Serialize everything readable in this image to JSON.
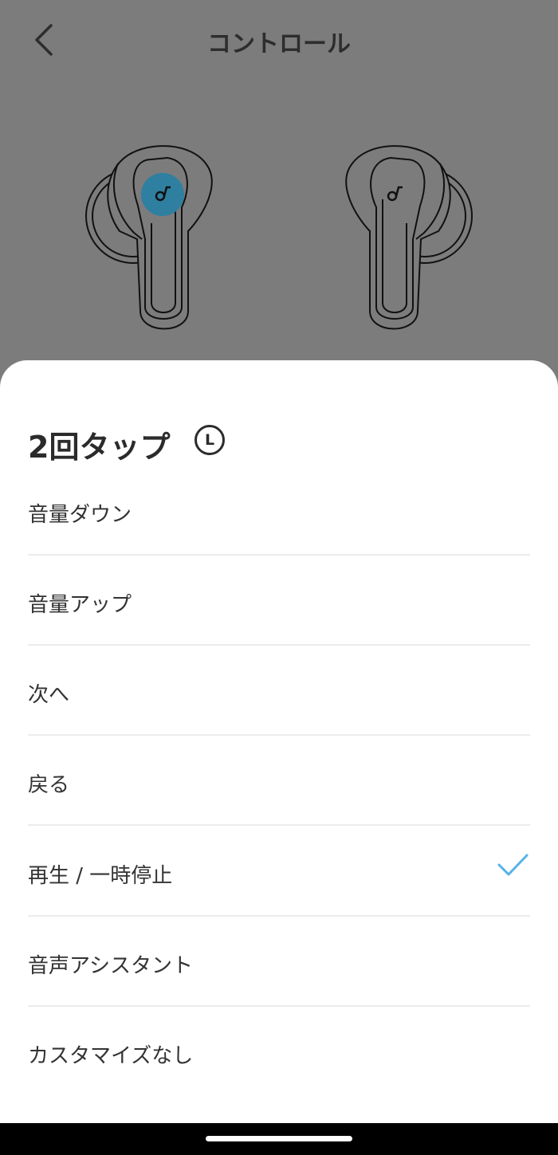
{
  "header": {
    "title": "コントロール",
    "back_icon": "chevron-left-icon"
  },
  "earbuds": {
    "left_logo_icon": "soundcore-logo-icon",
    "right_logo_icon": "soundcore-logo-icon",
    "highlight": "left",
    "highlight_color": "#2f7fa0"
  },
  "sheet": {
    "title": "2回タップ",
    "side_badge": "L",
    "options": [
      {
        "label": "音量ダウン",
        "selected": false
      },
      {
        "label": "音量アップ",
        "selected": false
      },
      {
        "label": "次へ",
        "selected": false
      },
      {
        "label": "戻る",
        "selected": false
      },
      {
        "label": "再生 / 一時停止",
        "selected": true
      },
      {
        "label": "音声アシスタント",
        "selected": false
      },
      {
        "label": "カスタマイズなし",
        "selected": false
      }
    ],
    "check_icon": "checkmark-icon",
    "check_color": "#56b2e8"
  }
}
